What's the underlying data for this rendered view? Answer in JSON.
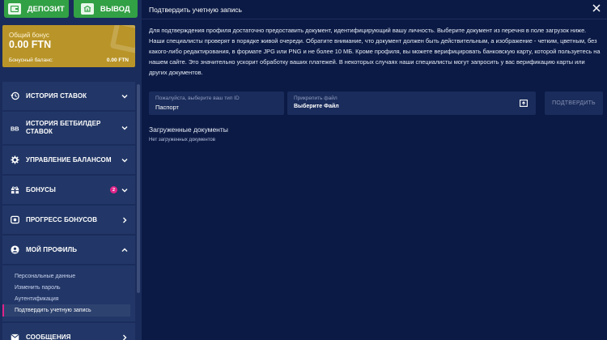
{
  "top_buttons": {
    "deposit_label": "ДЕПОЗИТ",
    "withdraw_label": "ВЫВОД"
  },
  "bonus_card": {
    "title": "Общий бонус",
    "amount": "0.00 FTN",
    "balance_label": "Бонусный баланс:",
    "balance_value": "0.00 FTN"
  },
  "menu": {
    "items": [
      {
        "label": "ИСТОРИЯ СТАВОК",
        "icon": "history-icon",
        "chevron": "down"
      },
      {
        "label": "ИСТОРИЯ БЕТБИЛДЕР СТАВОК",
        "icon": "betbuilder-icon",
        "chevron": "down"
      },
      {
        "label": "УПРАВЛЕНИЕ БАЛАНСОМ",
        "icon": "gear-icon",
        "chevron": "down"
      },
      {
        "label": "БОНУСЫ",
        "icon": "gift-icon",
        "chevron": "down",
        "badge": "2"
      },
      {
        "label": "ПРОГРЕСС БОНУСОВ",
        "icon": "progress-icon",
        "chevron": "right"
      },
      {
        "label": "МОЙ ПРОФИЛЬ",
        "icon": "user-icon",
        "chevron": "up"
      },
      {
        "label": "СООБЩЕНИЯ",
        "icon": "messages-icon",
        "chevron": "right"
      }
    ],
    "profile_sub": [
      "Персональные данные",
      "Изменить пароль",
      "Аутентификация",
      "Подтвердить учетную запись"
    ]
  },
  "main": {
    "title": "Подтвердить учетную запись",
    "description": "Для подтверждения профиля достаточно предоставить документ, идентифицирующий вашу личность. Выберите документ из перечня в поле загрузок ниже. Наши специалисты проверят в порядке живой очереди. Обратите внимание, что документ должен быть действительным, а изображение - четким, цветным, без какого-либо редактирования, в формате JPG или PNG и не более 10 МБ. Кроме профиля, вы можете верифицировать банковскую карту, которой пользуетесь на нашем сайте. Это значительно ускорит обработку ваших платежей. В некоторых случаях наши специалисты могут запросить у вас верификацию карты или других документов.",
    "doc_type_label": "Пожалуйста, выберите ваш тип ID",
    "doc_type_value": "Паспорт",
    "file_label": "Прикрепить файл",
    "file_value": "Выберите Файл",
    "confirm_label": "ПОДТВЕРДИТЬ",
    "uploaded_title": "Загруженные документы",
    "no_docs": "Нет загруженных документов"
  },
  "colors": {
    "green": "#32a045",
    "gold": "#b99428",
    "badge": "#e0248a",
    "panel": "#1a2c5b",
    "background": "#0b1a45"
  }
}
